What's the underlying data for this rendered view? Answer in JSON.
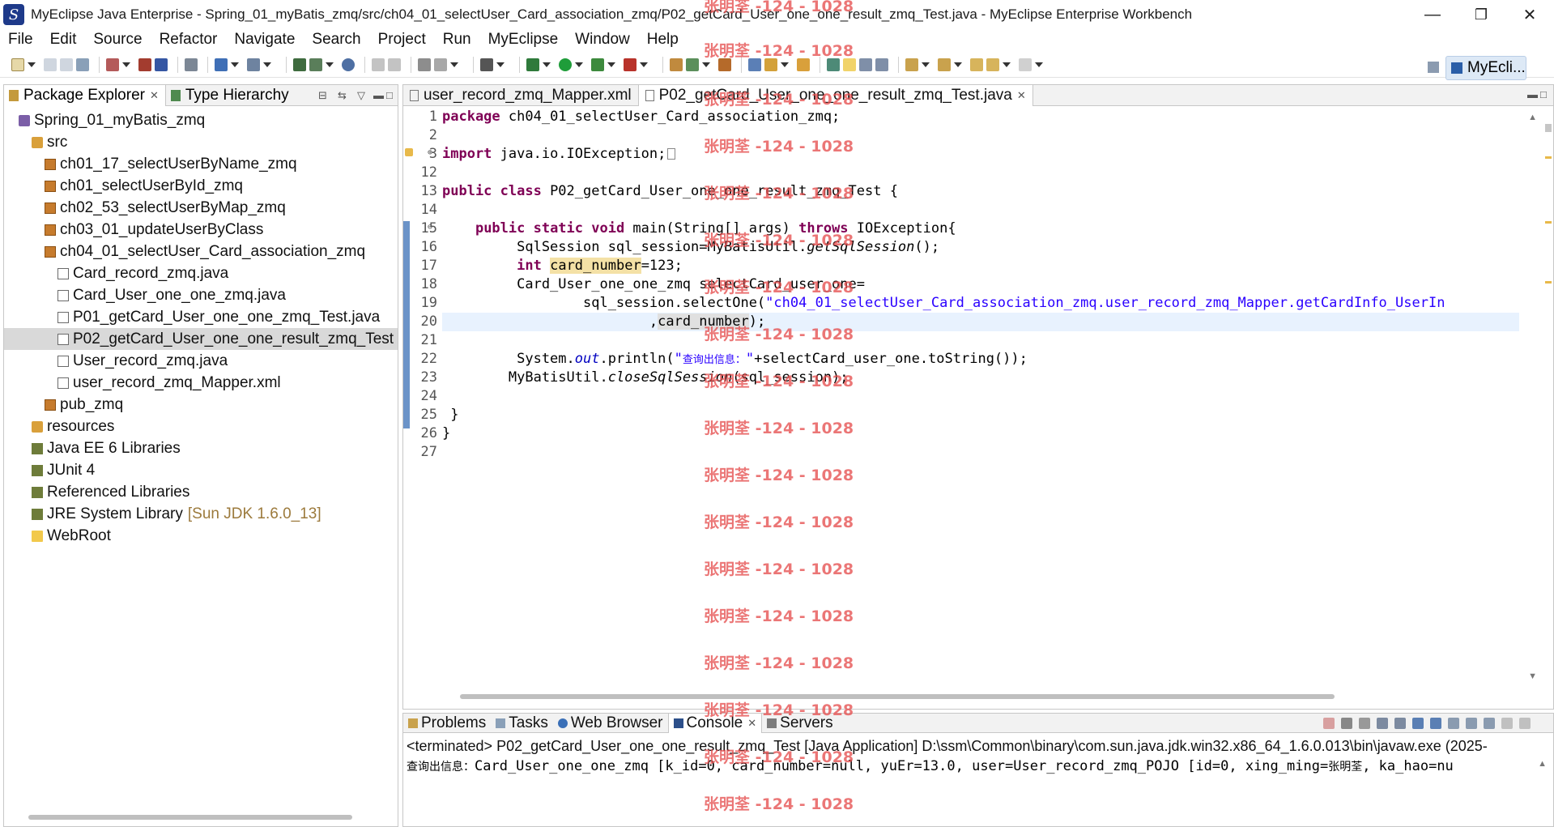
{
  "window": {
    "title": "MyEclipse Java Enterprise - Spring_01_myBatis_zmq/src/ch04_01_selectUser_Card_association_zmq/P02_getCard_User_one_one_result_zmq_Test.java - MyEclipse Enterprise Workbench",
    "controls": {
      "minimize": "—",
      "maximize": "❐",
      "close": "✕"
    }
  },
  "menu": [
    "File",
    "Edit",
    "Source",
    "Refactor",
    "Navigate",
    "Search",
    "Project",
    "Run",
    "MyEclipse",
    "Window",
    "Help"
  ],
  "perspective": {
    "label": "MyEcli..."
  },
  "package_explorer": {
    "tabs": [
      {
        "label": "Package Explorer",
        "active": true
      },
      {
        "label": "Type Hierarchy",
        "active": false
      }
    ],
    "tree": [
      {
        "label": "Spring_01_myBatis_zmq",
        "level": 0,
        "kind": "project"
      },
      {
        "label": "src",
        "level": 1,
        "kind": "source-folder"
      },
      {
        "label": "ch01_17_selectUserByName_zmq",
        "level": 2,
        "kind": "package"
      },
      {
        "label": "ch01_selectUserById_zmq",
        "level": 2,
        "kind": "package"
      },
      {
        "label": "ch02_53_selectUserByMap_zmq",
        "level": 2,
        "kind": "package"
      },
      {
        "label": "ch03_01_updateUserByClass",
        "level": 2,
        "kind": "package"
      },
      {
        "label": "ch04_01_selectUser_Card_association_zmq",
        "level": 2,
        "kind": "package"
      },
      {
        "label": "Card_record_zmq.java",
        "level": 3,
        "kind": "java"
      },
      {
        "label": "Card_User_one_one_zmq.java",
        "level": 3,
        "kind": "java"
      },
      {
        "label": "P01_getCard_User_one_one_zmq_Test.java",
        "level": 3,
        "kind": "java"
      },
      {
        "label": "P02_getCard_User_one_one_result_zmq_Test",
        "level": 3,
        "kind": "java",
        "selected": true
      },
      {
        "label": "User_record_zmq.java",
        "level": 3,
        "kind": "java"
      },
      {
        "label": "user_record_zmq_Mapper.xml",
        "level": 3,
        "kind": "xml"
      },
      {
        "label": "pub_zmq",
        "level": 2,
        "kind": "package"
      },
      {
        "label": "resources",
        "level": 1,
        "kind": "source-folder"
      },
      {
        "label": "Java EE 6 Libraries",
        "level": 1,
        "kind": "library"
      },
      {
        "label": "JUnit 4",
        "level": 1,
        "kind": "library"
      },
      {
        "label": "Referenced Libraries",
        "level": 1,
        "kind": "library"
      },
      {
        "label": "JRE System Library",
        "level": 1,
        "kind": "library",
        "suffix": "[Sun JDK 1.6.0_13]"
      },
      {
        "label": "WebRoot",
        "level": 1,
        "kind": "folder"
      }
    ]
  },
  "editor": {
    "tabs": [
      {
        "label": "user_record_zmq_Mapper.xml",
        "active": false
      },
      {
        "label": "P02_getCard_User_one_one_result_zmq_Test.java",
        "active": true
      }
    ],
    "line_numbers": [
      "1",
      "2",
      "3",
      "12",
      "13",
      "14",
      "15",
      "16",
      "17",
      "18",
      "19",
      "20",
      "21",
      "22",
      "23",
      "24",
      "25",
      "26",
      "27"
    ],
    "code": {
      "l1_kw": "package",
      "l1_rest": " ch04_01_selectUser_Card_association_zmq;",
      "l3_kw": "import",
      "l3_rest": " java.io.IOException;",
      "l13_kw": "public class",
      "l13_rest": " P02_getCard_User_one_one_result_zmq_Test {",
      "l15_indent": "    ",
      "l15_kw": "public static void",
      "l15_mid": " main(String[] args) ",
      "l15_kw2": "throws",
      "l15_rest": " IOException{",
      "l16_a": "         SqlSession sql_session=MyBatisUtil.",
      "l16_b": "getSqlSession",
      "l16_c": "();",
      "l17_indent": "         ",
      "l17_kw": "int",
      "l17_sp": " ",
      "l17_var": "card_number",
      "l17_rest": "=123;",
      "l18": "         Card_User_one_one_zmq selectCard_user_one=",
      "l19_a": "                 sql_session.selectOne(",
      "l19_str": "\"ch04_01_selectUser_Card_association_zmq.user_record_zmq_Mapper.getCardInfo_UserIn",
      "l20_a": "                         ,",
      "l20_var": "card_number",
      "l20_rest": ");",
      "l22_a": "         System.",
      "l22_out": "out",
      "l22_b": ".println(",
      "l22_str1": "\"",
      "l22_cjk": "查询出信息：",
      "l22_str2": "\"",
      "l22_rest": "+selectCard_user_one.toString());",
      "l23_a": "        MyBatisUtil.",
      "l23_b": "closeSqlSession",
      "l23_c": "(sql_session);",
      "l25": " }",
      "l26": "}"
    }
  },
  "console": {
    "tabs": [
      {
        "label": "Problems",
        "active": false
      },
      {
        "label": "Tasks",
        "active": false
      },
      {
        "label": "Web Browser",
        "active": false
      },
      {
        "label": "Console",
        "active": true
      },
      {
        "label": "Servers",
        "active": false
      }
    ],
    "status": "<terminated> P02_getCard_User_one_one_result_zmq_Test [Java Application] D:\\ssm\\Common\\binary\\com.sun.java.jdk.win32.x86_64_1.6.0.013\\bin\\javaw.exe (2025-",
    "output_prefix": "查询出信息：",
    "output_a": "Card_User_one_one_zmq [k_id=0, card_number=null, yuEr=13.0, user=User_record_zmq_POJO [id=0, xing_ming=",
    "output_cjk": "张明荃",
    "output_b": ", ka_hao=nu"
  },
  "watermark": "张明荃 -124 - 1028"
}
